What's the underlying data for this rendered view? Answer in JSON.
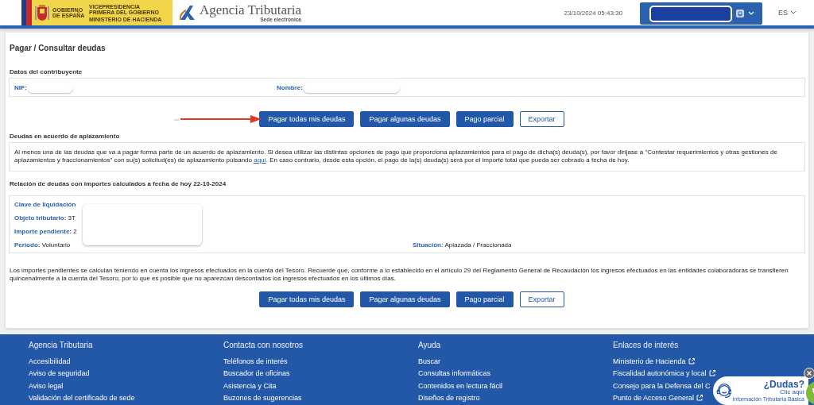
{
  "header": {
    "logo_lines": [
      "GOBIERNO DE ESPAÑA",
      "VICEPRESIDENCIA PRIMERA DEL GOBIERNO",
      "MINISTERIO DE HACIENDA"
    ],
    "brand": "Agencia Tributaria",
    "brand_sub": "Sede electrónica",
    "datetime": "23/10/2024 05:43:30",
    "language": "ES"
  },
  "page_title": "Pagar / Consultar deudas",
  "taxpayer": {
    "title": "Datos del contribuyente",
    "fields": [
      {
        "label": "NIF:"
      },
      {
        "label": "Nombre:"
      }
    ]
  },
  "actions_top": [
    {
      "label": "Pagar todas mis deudas",
      "kind": "primary"
    },
    {
      "label": "Pagar algunas deudas",
      "kind": "primary"
    },
    {
      "label": "Pago parcial",
      "kind": "primary"
    },
    {
      "label": "Exportar",
      "kind": "outline"
    }
  ],
  "notice": {
    "title": "Deudas en acuerdo de aplazamiento",
    "text_before": "Al menos una de las deudas que va a pagar forma parte de un acuerdo de aplazamiento. Si desea utilizar las distintas opciones de pago que proporciona aplazamientos para el pago de dicha(s) deuda(s), por favor diríjase a \"Contestar requerimientos y otras gestiones de aplazamientos y fraccionamientos\" con su(s) solicitud(es) de aplazamiento pulsando ",
    "link": "aquí",
    "text_after": ". En caso contrario, desde esta opción, el pago de la(s) deuda(s) será por el importe total que pueda ser cobrado a fecha de hoy."
  },
  "debts": {
    "title": "Relación de deudas con importes calculados a fecha de hoy 22-10-2024",
    "fields": [
      {
        "label": "Clave de liquidación"
      },
      {
        "label": "Objeto tributario:",
        "value": "3T"
      },
      {
        "label": "Importe pendiente:",
        "value": "2"
      }
    ],
    "bottom_fields": [
      {
        "label": "Periodo:",
        "value": "Voluntario"
      },
      {
        "label": "Situación:",
        "value": "Aplazada / Fraccionada"
      }
    ]
  },
  "info_text": "Los importes pendientes se calculan teniendo en cuenta los ingresos efectuados en la cuenta del Tesoro. Recuerde que, conforme a lo establecido en el artículo 29 del Reglamento General de Recaudación los ingresos efectuados en las entidades colaboradoras se transfieren quincenalmente a la cuenta del Tesoro, por lo que es posible que no aparezcan descontados los ingresos efectuados en los últimos días.",
  "actions_bottom": [
    {
      "label": "Pagar todas mis deudas",
      "kind": "primary"
    },
    {
      "label": "Pagar algunas deudas",
      "kind": "primary"
    },
    {
      "label": "Pago parcial",
      "kind": "primary"
    },
    {
      "label": "Exportar",
      "kind": "outline"
    }
  ],
  "footer": {
    "columns": [
      {
        "title": "Agencia Tributaria",
        "links": [
          {
            "label": "Accesibilidad",
            "external": false
          },
          {
            "label": "Aviso de seguridad",
            "external": false
          },
          {
            "label": "Aviso legal",
            "external": false
          },
          {
            "label": "Validación del certificado de sede",
            "external": false
          }
        ]
      },
      {
        "title": "Contacta con nosotros",
        "links": [
          {
            "label": "Teléfonos de interés",
            "external": false
          },
          {
            "label": "Buscador de oficinas",
            "external": false
          },
          {
            "label": "Asistencia y Cita",
            "external": false
          },
          {
            "label": "Buzones de sugerencias",
            "external": false
          }
        ]
      },
      {
        "title": "Ayuda",
        "links": [
          {
            "label": "Buscar",
            "external": false
          },
          {
            "label": "Consultas informáticas",
            "external": false
          },
          {
            "label": "Contenidos en lectura fácil",
            "external": false
          },
          {
            "label": "Diseños de registro",
            "external": false
          }
        ]
      },
      {
        "title": "Enlaces de interés",
        "links": [
          {
            "label": "Ministerio de Hacienda",
            "external": true
          },
          {
            "label": "Fiscalidad autonómica y local",
            "external": true
          },
          {
            "label": "Consejo para la Defensa del C",
            "external": false
          },
          {
            "label": "Punto de Acceso General",
            "external": true
          }
        ]
      }
    ]
  },
  "help_widget": {
    "title": "¿Dudas?",
    "action": "Clic aquí",
    "caption": "Información Tributaria Básica"
  }
}
